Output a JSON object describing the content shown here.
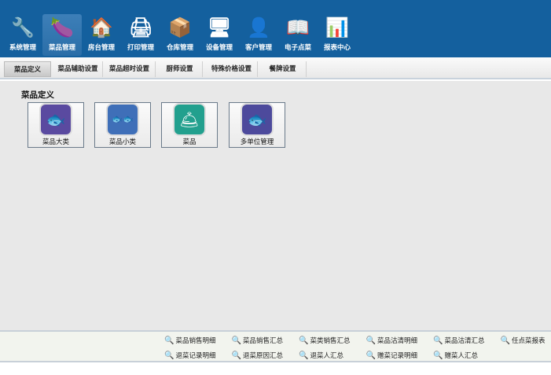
{
  "nav": [
    {
      "label": "系统管理",
      "icon": "tools-icon",
      "glyph": "🔧"
    },
    {
      "label": "菜品管理",
      "icon": "eggplant-icon",
      "glyph": "🍆"
    },
    {
      "label": "房台管理",
      "icon": "house-icon",
      "glyph": "🏠"
    },
    {
      "label": "打印管理",
      "icon": "printer-icon",
      "glyph": "🖨"
    },
    {
      "label": "仓库管理",
      "icon": "warehouse-box-icon",
      "glyph": "📦"
    },
    {
      "label": "设备管理",
      "icon": "device-add-icon",
      "glyph": "🖥"
    },
    {
      "label": "客户管理",
      "icon": "customer-headset-icon",
      "glyph": "👤"
    },
    {
      "label": "电子点菜",
      "icon": "menu-tablet-icon",
      "glyph": "📖"
    },
    {
      "label": "报表中心",
      "icon": "bar-chart-icon",
      "glyph": "📊"
    }
  ],
  "tabs": [
    "菜品定义",
    "菜品辅助设置",
    "菜品超时设置",
    "厨师设置",
    "特殊价格设置",
    "餐牌设置"
  ],
  "section_title": "菜品定义",
  "buttons": [
    {
      "label": "菜品大类",
      "color": "#5a4aa0",
      "glyph": "🐟"
    },
    {
      "label": "菜品小类",
      "color": "#3f6fb8",
      "glyph": "🐟🐟"
    },
    {
      "label": "菜品",
      "color": "#22a08e",
      "glyph": "🛎"
    },
    {
      "label": "多单位管理",
      "color": "#4d4a9c",
      "glyph": "🐟"
    }
  ],
  "reports_row1": [
    "菜品销售明细",
    "菜品销售汇总",
    "菜类销售汇总",
    "菜品沽清明细",
    "菜品沽清汇总",
    "任点菜报表"
  ],
  "reports_row2": [
    "退菜记录明细",
    "退菜原因汇总",
    "退菜人汇总",
    "赠菜记录明细",
    "赠菜人汇总"
  ]
}
